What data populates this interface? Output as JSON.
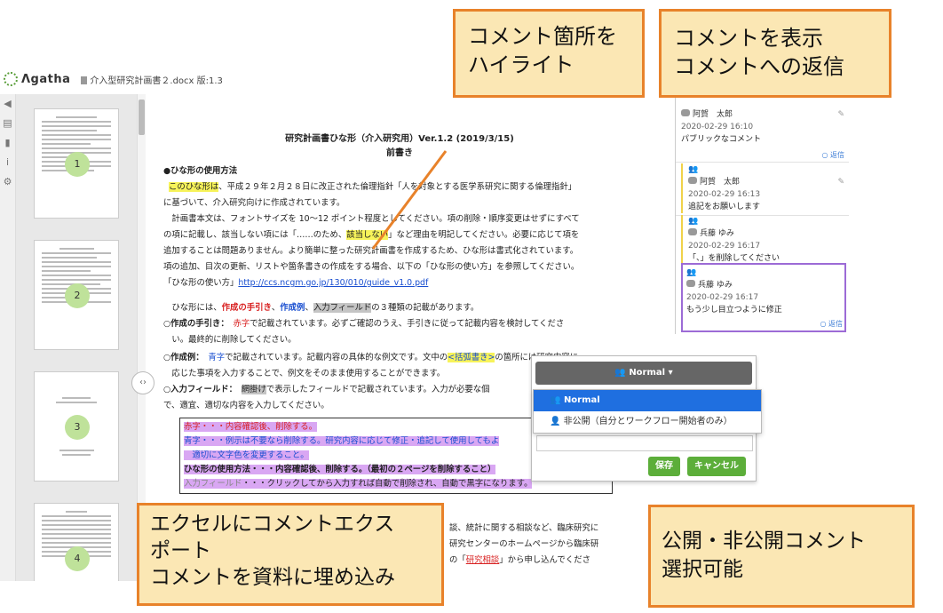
{
  "app": {
    "logo_text": "Λgatha",
    "doc_title": "介入型研究計画書２.docx 版:1.3"
  },
  "thumbnails": [
    {
      "page": "1"
    },
    {
      "page": "2"
    },
    {
      "page": "3"
    },
    {
      "page": "4"
    }
  ],
  "doc": {
    "title1": "研究計画書ひな形（介入研究用）Ver.1.2 (2019/3/15)",
    "title2": "前書き",
    "heading": "●ひな形の使用方法",
    "l1a": "このひな形は",
    "l1b": "、平成２９年２月２８日に改正された倫理指針「人を対象とする医学系研究に関する倫理指針」",
    "l2": "に基づいて、介入研究向けに作成されています。",
    "l3": "　計画書本文は、フォントサイズを 10〜12 ポイント程度としてください。項の削除・順序変更はせずにすべて",
    "l4a": "の項に記載し、該当しない項には「……のため、",
    "l4b": "該当しない",
    "l4c": "」など理由を明記してください。必要に応じて項を",
    "l5": "追加することは問題ありません。より簡単に整った研究計画書を作成するため、ひな形は書式化されています。",
    "l6": "項の追加、目次の更新、リストや箇条書きの作成をする場合、以下の「ひな形の使い方」を参照してください。",
    "l7a": "「ひな形の使い方」",
    "l7b": "http://ccs.ncgm.go.jp/130/010/guide_v1.0.pdf",
    "l8a": "　ひな形には、",
    "l8b": "作成の手引き",
    "l8c": "、",
    "l8d": "作成例",
    "l8e": "、",
    "l8f": "入力フィールド",
    "l8g": "の３種類の記載があります。",
    "l9a": "○作成の手引き：　",
    "l9b": "赤字",
    "l9c": "で記載されています。必ずご確認のうえ、手引きに従って記載内容を検討してくださ",
    "l10": "　い。最終的に削除してください。",
    "l11a": "○作成例：　",
    "l11b": "青字",
    "l11c": "で記載されています。記載内容の具体的な例文です。文中の",
    "l11d": "<括弧書き>",
    "l11e": "の箇所には研究内容に",
    "l12": "　応じた事項を入力することで、例文をそのまま使用することができます。",
    "l13a": "○入力フィールド：　",
    "l13b": "網掛け",
    "l13c": "で表示したフィールドで記載されています。入力が必要な個",
    "l14": "で、適宜、適切な内容を入力してください。",
    "box1a": "赤字",
    "box1b": "・・・内容確認後、削除する。",
    "box2a": "青字",
    "box2b": "・・・例示は不要なら削除する。研究内容に応じて修正・追記して使用してもよ",
    "box3": "　適切に文字色を変更すること。",
    "box4": "ひな形の使用方法・・・内容確認後、削除する。（最初の２ページを削除すること）",
    "box5a": "入力フィールド",
    "box5b": "・・・クリックしてから入力すれば自動で削除され、自動で黒字になります。",
    "b1": "談、統計に関する相談など、臨床研究に",
    "b2": "研究センターのホームページから臨床研",
    "b3a": "の「",
    "b3b": "研究相談",
    "b3c": "」から申し込んでくださ"
  },
  "comments": [
    {
      "name": "阿賀　太郎",
      "date": "2020-02-29 16:10",
      "text": "パブリックなコメント",
      "reply": "返信"
    },
    {
      "name": "阿賀　太郎",
      "date": "2020-02-29 16:13",
      "text": "追記をお願いします"
    },
    {
      "name": "兵藤 ゆみ",
      "date": "2020-02-29 16:17",
      "text": "「、」を削除してください"
    },
    {
      "name": "兵藤 ゆみ",
      "date": "2020-02-29 16:17",
      "text": "もう少し目立つように修正",
      "reply": "返信"
    }
  ],
  "popup": {
    "visibility_button": "Normal",
    "options": [
      "Normal",
      "非公開（自分とワークフロー開始者のみ）"
    ],
    "save": "保存",
    "cancel": "キャンセル"
  },
  "callouts": {
    "highlight": [
      "コメント箇所を",
      "ハイライト"
    ],
    "display": [
      "コメントを表示",
      "コメントへの返信"
    ],
    "export": [
      "エクセルにコメントエクス",
      "ポート",
      "コメントを資料に埋め込み"
    ],
    "public": [
      "公開・非公開コメント",
      "選択可能"
    ]
  }
}
